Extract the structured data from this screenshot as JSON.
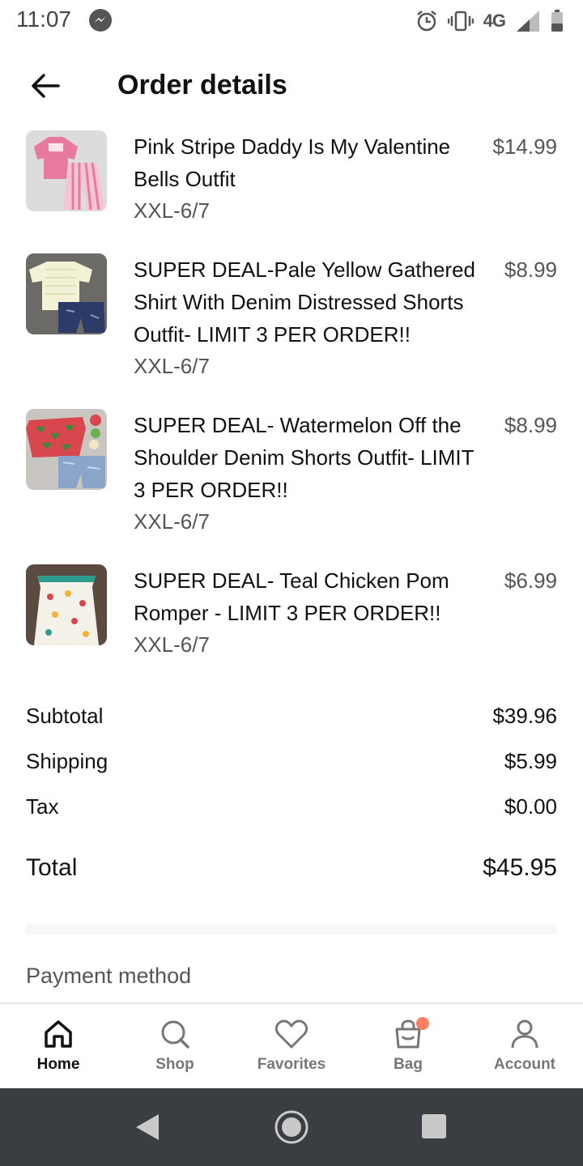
{
  "status_bar": {
    "time": "11:07",
    "network": "4G",
    "icons": [
      "messenger-icon",
      "alarm-icon",
      "vibrate-icon",
      "signal-icon",
      "battery-icon"
    ]
  },
  "header": {
    "title": "Order details",
    "back_icon": "arrow-left-icon"
  },
  "items": [
    {
      "name": "Pink Stripe Daddy Is My Valentine Bells Outfit",
      "size": "XXL-6/7",
      "price": "$14.99",
      "thumb_colors": [
        "#e87aa0",
        "#f4c5d5"
      ]
    },
    {
      "name": "SUPER DEAL-Pale Yellow Gathered Shirt With Denim Distressed Shorts Outfit- LIMIT 3 PER ORDER!!",
      "size": "XXL-6/7",
      "price": "$8.99",
      "thumb_colors": [
        "#f3f1d6",
        "#2c3c66"
      ]
    },
    {
      "name": "SUPER DEAL- Watermelon Off the Shoulder Denim Shorts Outfit- LIMIT 3 PER ORDER!!",
      "size": "XXL-6/7",
      "price": "$8.99",
      "thumb_colors": [
        "#d8464e",
        "#8aa5c9"
      ]
    },
    {
      "name": "SUPER DEAL- Teal Chicken Pom Romper - LIMIT 3 PER ORDER!!",
      "size": "XXL-6/7",
      "price": "$6.99",
      "thumb_colors": [
        "#f4f1e9",
        "#2f9a8e"
      ]
    }
  ],
  "summary": {
    "subtotal_label": "Subtotal",
    "subtotal_value": "$39.96",
    "shipping_label": "Shipping",
    "shipping_value": "$5.99",
    "tax_label": "Tax",
    "tax_value": "$0.00",
    "total_label": "Total",
    "total_value": "$45.95"
  },
  "payment": {
    "label": "Payment method"
  },
  "bottom_nav": {
    "items": [
      {
        "label": "Home",
        "icon": "home-icon",
        "active": true
      },
      {
        "label": "Shop",
        "icon": "search-icon",
        "active": false
      },
      {
        "label": "Favorites",
        "icon": "heart-icon",
        "active": false
      },
      {
        "label": "Bag",
        "icon": "bag-icon",
        "active": false,
        "badge_color": "#ff7f64"
      },
      {
        "label": "Account",
        "icon": "person-icon",
        "active": false
      }
    ]
  },
  "system_nav": {
    "icons": [
      "back-triangle-icon",
      "home-circle-icon",
      "recents-square-icon"
    ]
  }
}
